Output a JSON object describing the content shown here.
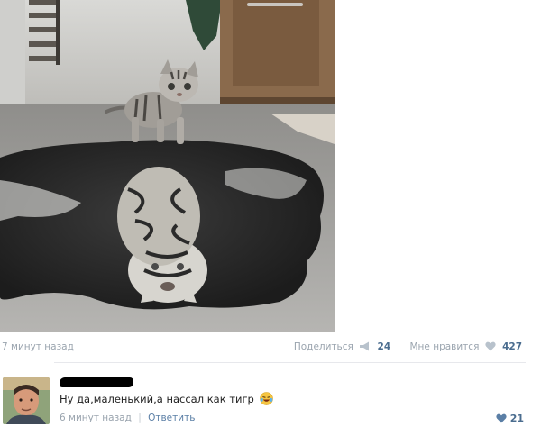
{
  "post": {
    "time": "7 минут назад",
    "share_label": "Поделиться",
    "share_count": "24",
    "like_label": "Мне нравится",
    "like_count": "427",
    "image_icon": "kitten-tiger-reflection-image"
  },
  "comment": {
    "text": "Ну да,маленький,а нассал как тигр",
    "emoji_icon": "laughing-tears-emoji-icon",
    "time": "6 минут назад",
    "separator": "|",
    "reply_label": "Ответить",
    "like_count": "21"
  },
  "colors": {
    "meta_text": "#9aa4ae",
    "count_text": "#4b6d8f",
    "link": "#5b7fa6",
    "divider": "#e7e8ec"
  }
}
